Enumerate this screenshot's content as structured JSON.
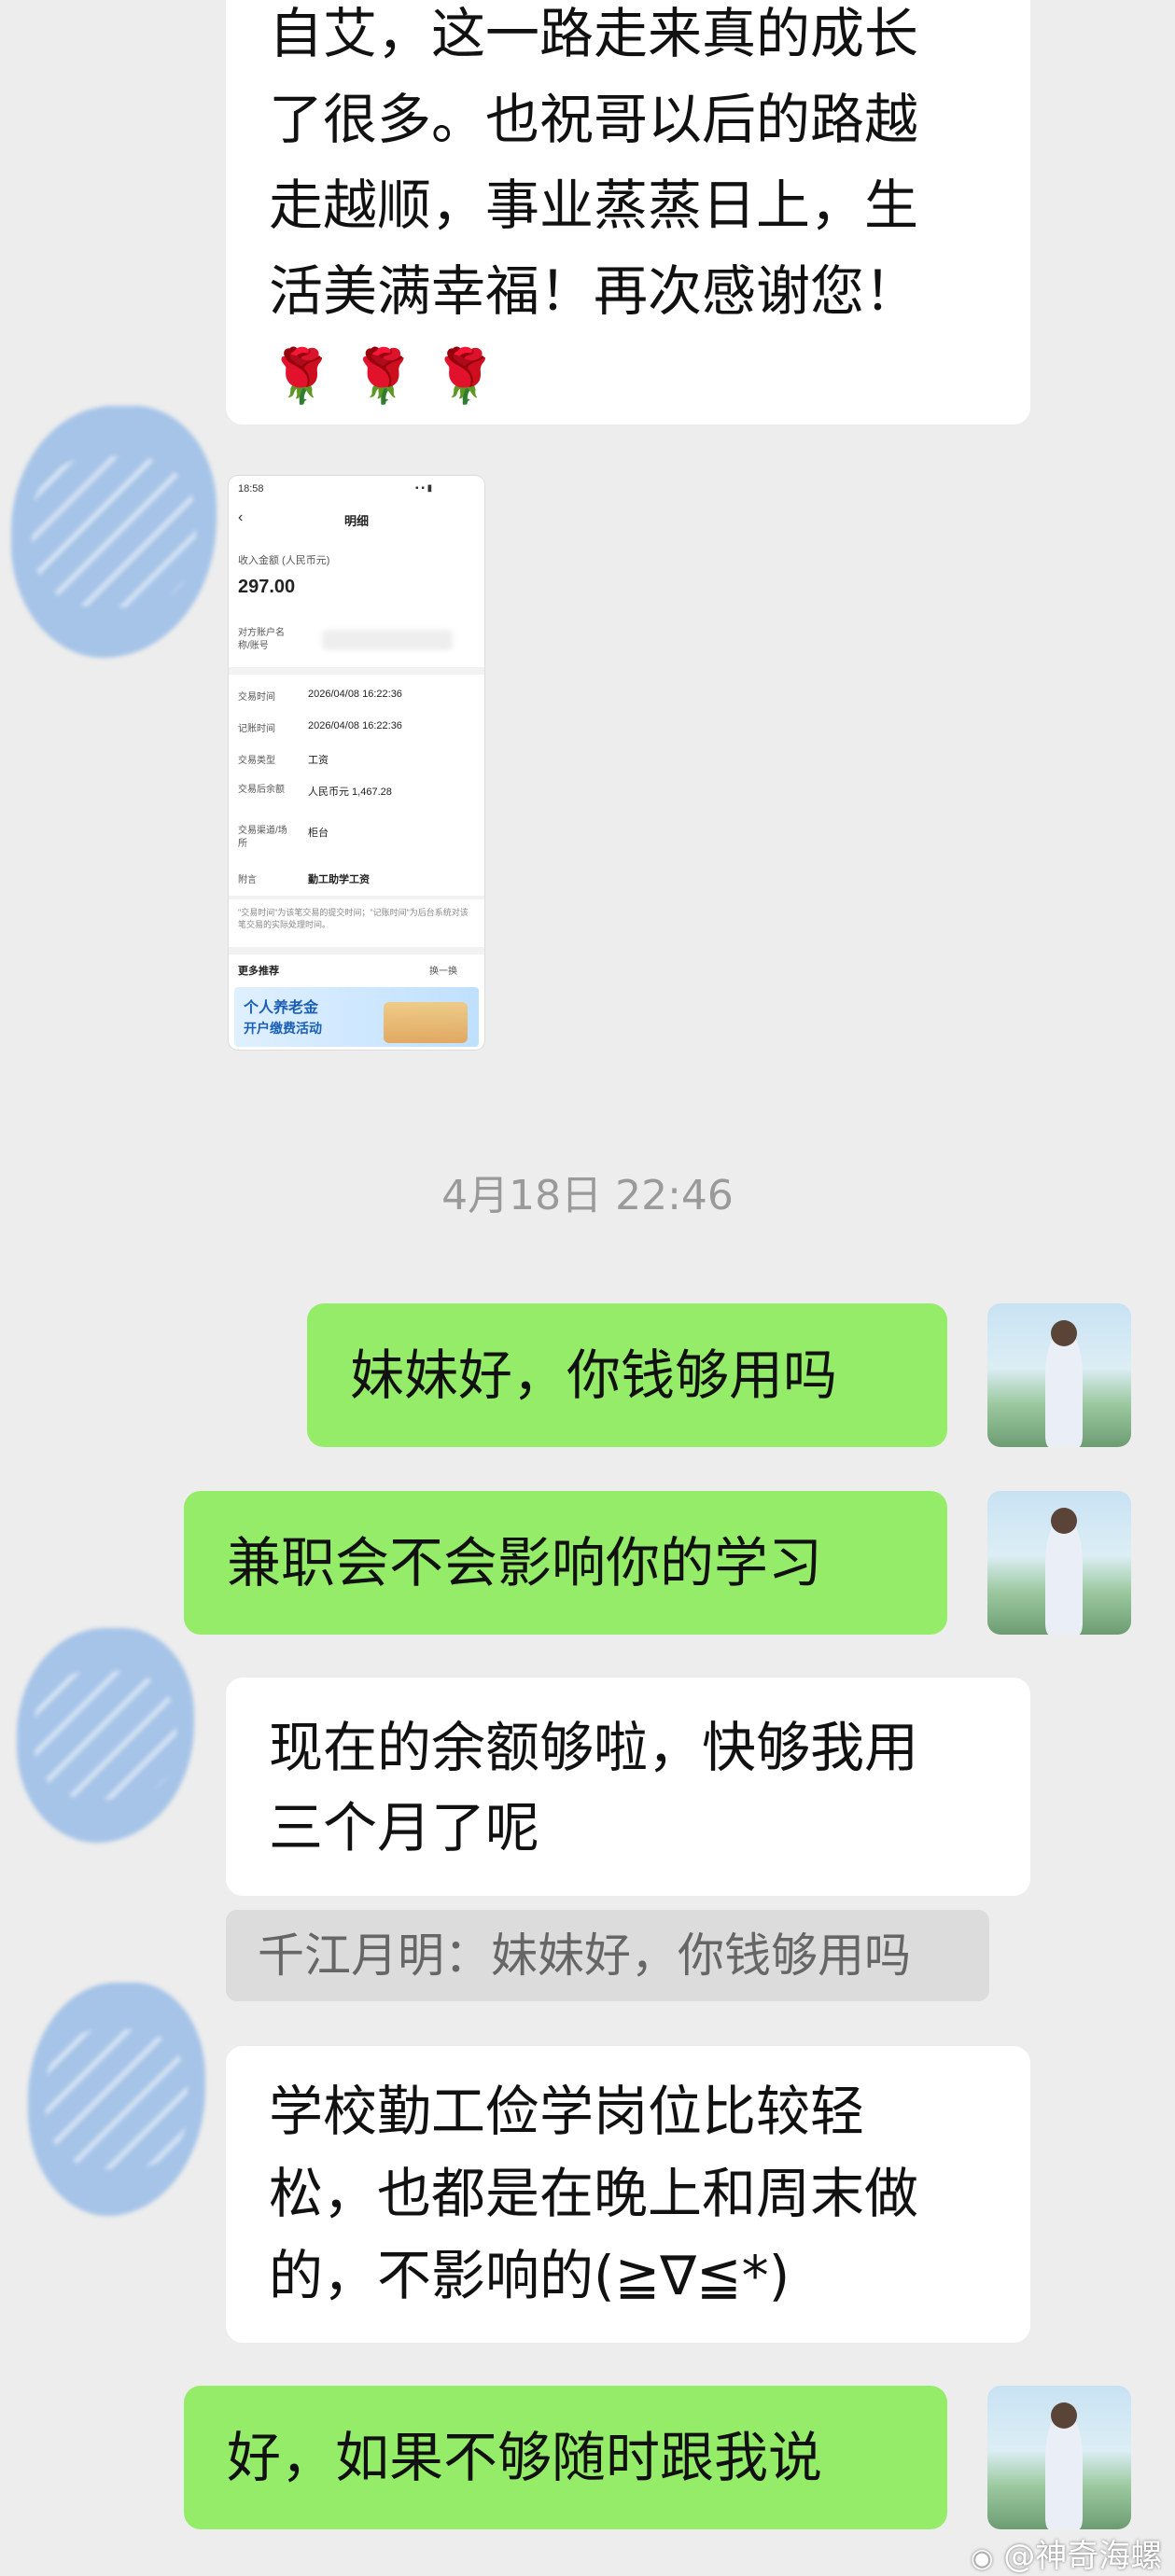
{
  "top_message": {
    "lines": [
      "自艾，这一路走来真的成长",
      "了很多。也祝哥以后的路越",
      "走越顺，事业蒸蒸日上，生",
      "活美满幸福！再次感谢您！"
    ],
    "emoji": "🌹 🌹 🌹"
  },
  "receipt": {
    "status_time": "18:58",
    "title": "明细",
    "amount_label": "收入金额 (人民币元)",
    "amount": "297.00",
    "counterparty_label": "对方账户名称/账号",
    "rows": [
      {
        "label": "交易时间",
        "value": "2026/04/08 16:22:36"
      },
      {
        "label": "记账时间",
        "value": "2026/04/08 16:22:36"
      },
      {
        "label": "交易类型",
        "value": "工资"
      },
      {
        "label": "交易后余额",
        "value": "人民币元 1,467.28"
      },
      {
        "label": "交易渠道/场所",
        "value": "柜台"
      },
      {
        "label": "附言",
        "value": "勤工助学工资"
      }
    ],
    "note": "\"交易时间\"为该笔交易的提交时间；\"记账时间\"为后台系统对该笔交易的实际处理时间。",
    "more_label": "更多推荐",
    "refresh_label": "换一换",
    "banner_line1": "个人养老金",
    "banner_line2": "开户缴费活动"
  },
  "timestamp": "4月18日 22:46",
  "messages": [
    {
      "side": "right",
      "text": "妹妹好，你钱够用吗"
    },
    {
      "side": "right",
      "text": "兼职会不会影响你的学习"
    },
    {
      "side": "left",
      "lines": [
        "现在的余额够啦，快够我用",
        "三个月了呢"
      ]
    },
    {
      "side": "left",
      "lines": [
        "学校勤工俭学岗位比较轻",
        "松，也都是在晚上和周末做",
        "的，不影响的(≧∇≦*)"
      ]
    },
    {
      "side": "right",
      "text": "好，如果不够随时跟我说"
    }
  ],
  "quote": "千江月明：妹妹好，你钱够用吗",
  "watermark": "@神奇海螺"
}
